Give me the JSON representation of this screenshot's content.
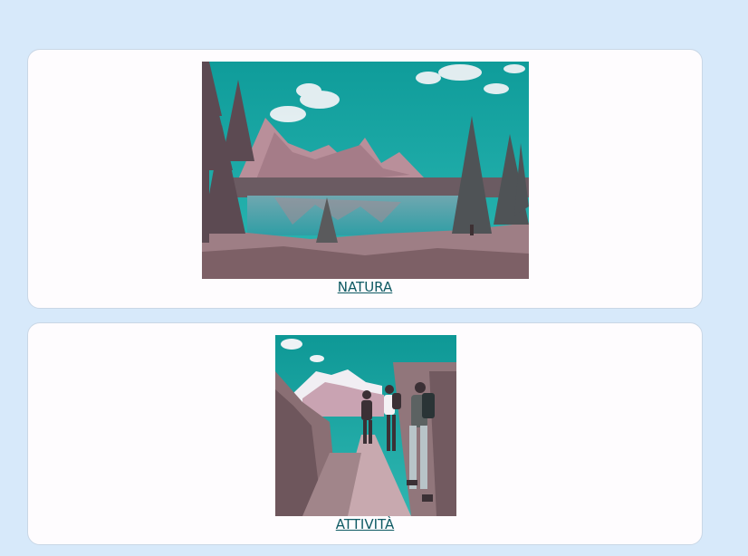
{
  "cards": [
    {
      "caption": "NATURA",
      "image_subject": "mountain-lake-landscape"
    },
    {
      "caption": "ATTIVITÀ",
      "image_subject": "hikers-on-mountain-trail"
    }
  ],
  "colors": {
    "page_background": "#d7e9fa",
    "card_background": "#fefcfe",
    "link_color": "#0e5a63",
    "sky_teal": "#1aa7a4"
  }
}
